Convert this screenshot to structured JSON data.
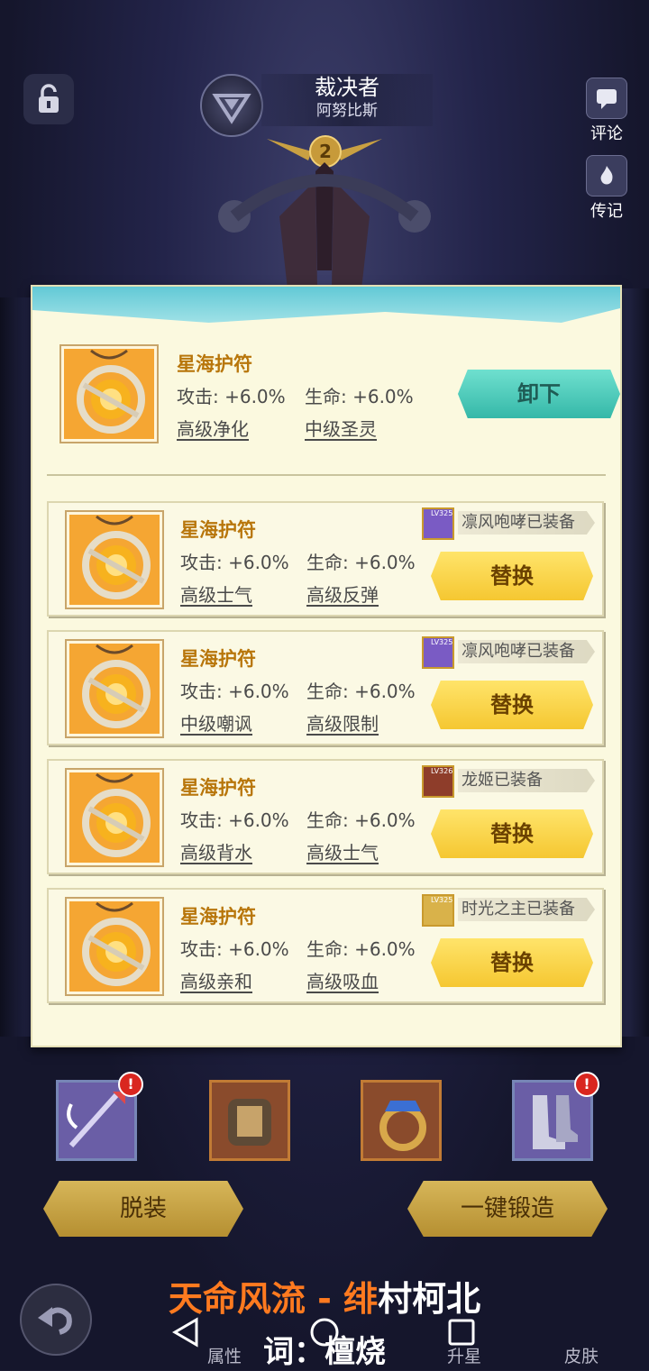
{
  "header": {
    "hero_class": "裁决者",
    "hero_name": "阿努比斯",
    "star_level": "2",
    "side_buttons": [
      {
        "label": "评论",
        "icon": "comment-icon"
      },
      {
        "label": "传记",
        "icon": "biography-icon"
      }
    ]
  },
  "equipped": {
    "name": "星海护符",
    "attack": "攻击: +6.0%",
    "hp": "生命: +6.0%",
    "sub1": "高级净化",
    "sub2": "中级圣灵",
    "action": "卸下"
  },
  "items": [
    {
      "name": "星海护符",
      "attack": "攻击: +6.0%",
      "hp": "生命: +6.0%",
      "sub1": "高级士气",
      "sub2": "高级反弹",
      "owner_lv": "LV325",
      "owner_tag": "凛风咆哮已装备",
      "action": "替换",
      "avatar_color": "#7a5bc4"
    },
    {
      "name": "星海护符",
      "attack": "攻击: +6.0%",
      "hp": "生命: +6.0%",
      "sub1": "中级嘲讽",
      "sub2": "高级限制",
      "owner_lv": "LV325",
      "owner_tag": "凛风咆哮已装备",
      "action": "替换",
      "avatar_color": "#7a5bc4"
    },
    {
      "name": "星海护符",
      "attack": "攻击: +6.0%",
      "hp": "生命: +6.0%",
      "sub1": "高级背水",
      "sub2": "高级士气",
      "owner_lv": "LV326",
      "owner_tag": "龙姬已装备",
      "action": "替换",
      "avatar_color": "#8e3d2a"
    },
    {
      "name": "星海护符",
      "attack": "攻击: +6.0%",
      "hp": "生命: +6.0%",
      "sub1": "高级亲和",
      "sub2": "高级吸血",
      "owner_lv": "LV325",
      "owner_tag": "时光之主已装备",
      "action": "替换",
      "avatar_color": "#d9b24a"
    }
  ],
  "buttons": {
    "unequip_all": "脱装",
    "one_key_forge": "一键锻造"
  },
  "bottom_tabs": [
    "属性",
    "升星",
    "皮肤"
  ],
  "lyrics": {
    "line1_orange": "天命风流 - 绯",
    "line1_white": "村柯北",
    "line2": "词：檀烧"
  }
}
